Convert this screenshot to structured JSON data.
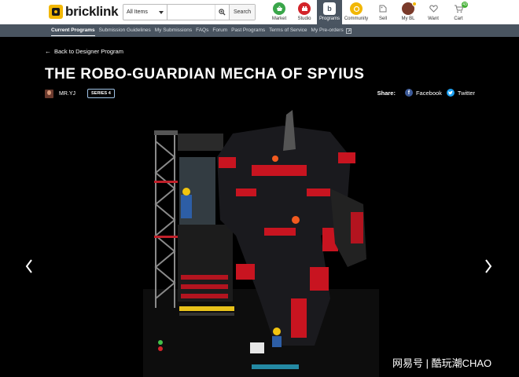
{
  "brand": {
    "logo_text": "bricklink"
  },
  "search": {
    "category": "All Items",
    "placeholder": "",
    "button_label": "Search"
  },
  "navicons": [
    {
      "label": "Market",
      "icon": "market-basket-icon",
      "color": "#3aa64a"
    },
    {
      "label": "Studio",
      "icon": "studio-icon",
      "color": "#d3242a"
    },
    {
      "label": "Programs",
      "icon": "programs-icon",
      "color": "#ffffff"
    },
    {
      "label": "Community",
      "icon": "community-icon",
      "color": "#f2b705"
    },
    {
      "label": "Sell",
      "icon": "sell-icon",
      "color": "#888888"
    },
    {
      "label": "My BL",
      "icon": "avatar-icon",
      "color": "#7a3a2a"
    },
    {
      "label": "Want",
      "icon": "heart-icon",
      "color": "#888888"
    },
    {
      "label": "Cart",
      "icon": "cart-icon",
      "color": "#888888",
      "badge": "43"
    }
  ],
  "subnav": [
    "Current Programs",
    "Submission Guidelines",
    "My Submissions",
    "FAQs",
    "Forum",
    "Past Programs",
    "Terms of Service",
    "My Pre-orders"
  ],
  "page": {
    "back_label": "Back to Designer Program",
    "title": "THE ROBO-GUARDIAN MECHA OF SPYIUS",
    "author": "MR.YJ",
    "series": "SERIES 4",
    "share_label": "Share:",
    "share_facebook": "Facebook",
    "share_twitter": "Twitter"
  },
  "watermark": "网易号 | 酷玩潮CHAO",
  "colors": {
    "subnav_bg": "#495460",
    "active_tab_bg": "#4a5561",
    "accent_red": "#d3242a"
  }
}
